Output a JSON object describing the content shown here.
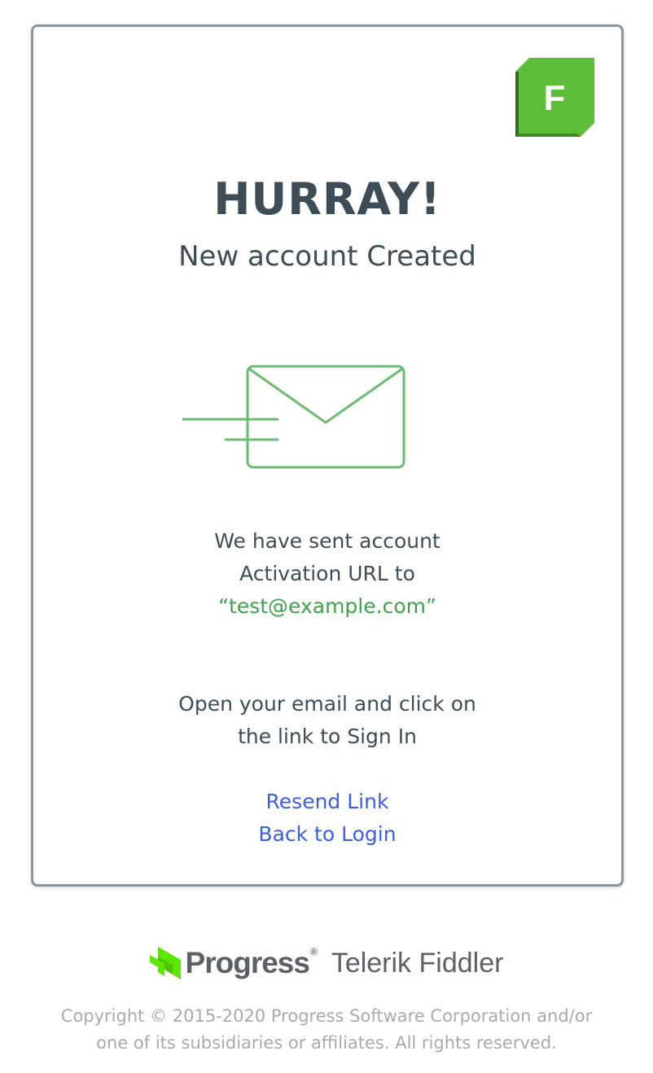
{
  "colors": {
    "heading": "#3d4d57",
    "accent_green": "#3fa34d",
    "link_blue": "#3b5fe0",
    "card_border": "#8a959d",
    "footer_text": "#a7abaf"
  },
  "app_logo": {
    "letter": "F",
    "icon": "fiddler-f-icon"
  },
  "header": {
    "title": "HURRAY!",
    "subtitle": "New account Created"
  },
  "illustration": {
    "icon": "envelope-sent-icon"
  },
  "message": {
    "line1": "We have sent account",
    "line2": "Activation URL to",
    "email": "“test@example.com”"
  },
  "instructions": {
    "line1": "Open your email and click on",
    "line2": "the link to Sign In"
  },
  "links": {
    "resend": "Resend Link",
    "back_to_login": "Back to Login"
  },
  "footer": {
    "company": "Progress",
    "product": "Telerik Fiddler",
    "copyright_line1": "Copyright © 2015-2020 Progress Software Corporation and/or",
    "copyright_line2": "one of its subsidiaries or affiliates. All rights reserved."
  }
}
